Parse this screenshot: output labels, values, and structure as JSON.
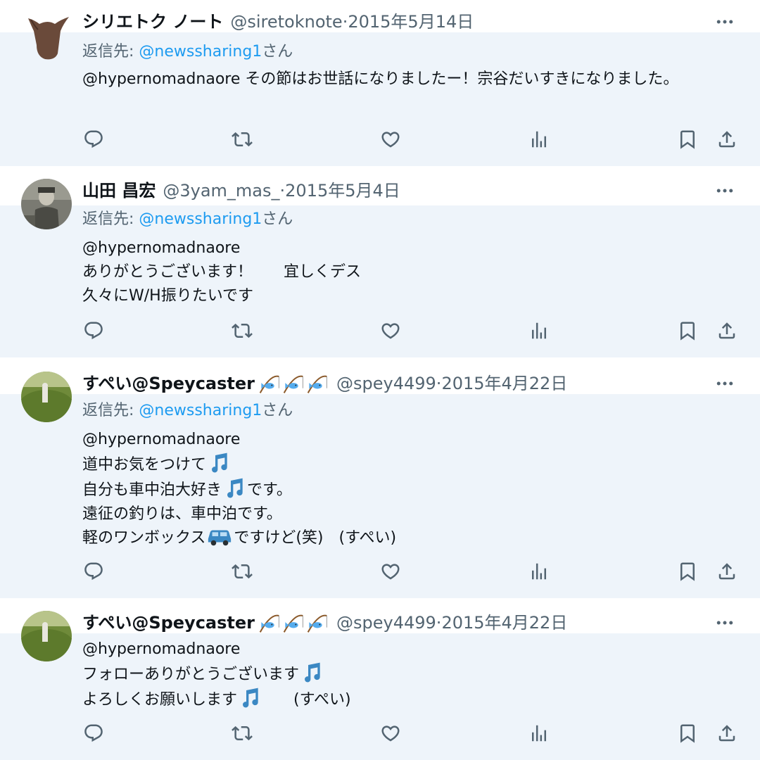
{
  "tweets": [
    {
      "display_name": "シリエトク ノート",
      "handle": "@siretoknote",
      "date": "2015年5月14日",
      "reply_prefix": "返信先: ",
      "reply_handle": "@newssharing1",
      "reply_suffix": "さん",
      "text_lines": [
        "@hypernomadnaore その節はお世話になりましたー！宗谷だいすきになりました。"
      ],
      "avatar": "brown-dog-head-icon"
    },
    {
      "display_name": "山田 昌宏",
      "handle": "@3yam_mas_",
      "date": "2015年5月4日",
      "reply_prefix": "返信先: ",
      "reply_handle": "@newssharing1",
      "reply_suffix": "さん",
      "text_lines": [
        "@hypernomadnaore",
        "ありがとうございます！　　宜しくデス",
        "久々にW/H振りたいです"
      ],
      "avatar": "child-photo"
    },
    {
      "display_name": "すぺい@Speycaster",
      "name_emojis": [
        "fishing-pole-emoji",
        "fishing-pole-emoji",
        "fishing-pole-emoji"
      ],
      "handle": "@spey4499",
      "date": "2015年4月22日",
      "reply_prefix": "返信先: ",
      "reply_handle": "@newssharing1",
      "reply_suffix": "さん",
      "text_lines": [
        "@hypernomadnaore",
        "道中お気をつけて",
        "自分も車中泊大好き",
        "です。",
        "遠征の釣りは、車中泊です。",
        "軽のワンボックス",
        "ですけど(笑)　(すぺい)"
      ],
      "avatar": "field-photo"
    },
    {
      "display_name": "すぺい@Speycaster",
      "name_emojis": [
        "fishing-pole-emoji",
        "fishing-pole-emoji",
        "fishing-pole-emoji"
      ],
      "handle": "@spey4499",
      "date": "2015年4月22日",
      "text_lines": [
        "@hypernomadnaore",
        "フォローありがとうございます",
        "よろしくお願いします",
        "　　(すぺい)"
      ],
      "avatar": "field-photo"
    }
  ],
  "separator": " · ",
  "icons": {
    "reply": "reply-icon",
    "retweet": "retweet-icon",
    "like": "heart-icon",
    "views": "views-icon",
    "bookmark": "bookmark-icon",
    "share": "share-icon",
    "more": "more-icon",
    "music": "music-note-emoji",
    "car": "car-emoji"
  },
  "colors": {
    "link": "#1d9bf0",
    "secondary_text": "#536471",
    "icon": "#536471"
  }
}
